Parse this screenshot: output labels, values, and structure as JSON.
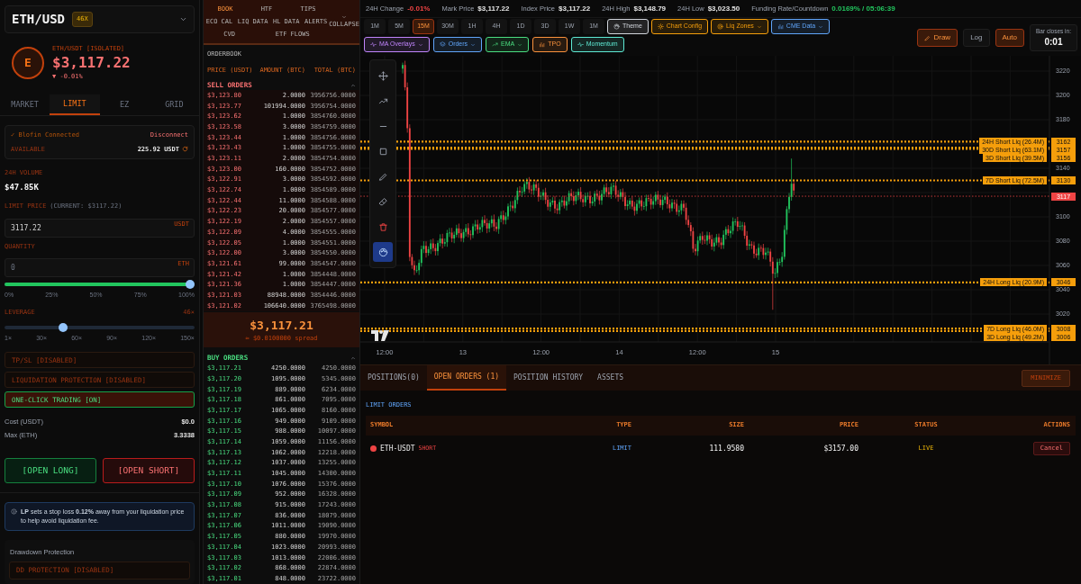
{
  "pair_selector": {
    "symbol": "ETH/USD",
    "leverage_badge": "46X"
  },
  "ticker": {
    "avatar_letter": "E",
    "market": "ETH/USDT [ISOLATED]",
    "price": "$3,117.22",
    "change": "▼ -0.01%"
  },
  "order_tabs": [
    {
      "label": "MARKET",
      "selected": false
    },
    {
      "label": "LIMIT",
      "selected": true
    },
    {
      "label": "EZ",
      "selected": false
    },
    {
      "label": "GRID",
      "selected": false
    }
  ],
  "connection": {
    "status": "✓ Blofin Connected",
    "action": "Disconnect",
    "available_label": "AVAILABLE",
    "available_value": "225.92 USDT"
  },
  "volume": {
    "label": "24H VOLUME",
    "value": "$47.85K"
  },
  "limit_price": {
    "label": "LIMIT PRICE",
    "hint": "(CURRENT: $3117.22)",
    "value": "3117.22",
    "unit": "USDT"
  },
  "quantity": {
    "label": "QUANTITY",
    "placeholder": "0",
    "unit": "ETH"
  },
  "quantity_slider": {
    "level": 1.0,
    "ticks": [
      "0%",
      "25%",
      "50%",
      "75%",
      "100%"
    ]
  },
  "leverage": {
    "label": "LEVERAGE",
    "value": "46×",
    "level": 0.3,
    "ticks": [
      "1×",
      "30×",
      "60×",
      "90×",
      "120×",
      "150×"
    ]
  },
  "toggles": [
    {
      "label": "TP/SL [DISABLED]",
      "on": false
    },
    {
      "label": "LIQUIDATION PROTECTION [DISABLED]",
      "on": false
    },
    {
      "label": "ONE-CLICK TRADING [ON]",
      "on": true
    }
  ],
  "summary": [
    {
      "label": "Cost (USDT)",
      "value": "$0.0"
    },
    {
      "label": "Max (ETH)",
      "value": "3.3338"
    }
  ],
  "actions": [
    {
      "label": "[OPEN LONG]",
      "kind": "long"
    },
    {
      "label": "[OPEN SHORT]",
      "kind": "short"
    }
  ],
  "info": "**LP** sets a stop loss **0.12%** away from your liquidation price to help avoid liquidation fee.",
  "drawdown": {
    "label": "Drawdown Protection",
    "toggle": {
      "label": "DD PROTECTION [DISABLED]",
      "on": false
    }
  },
  "orderbook": {
    "tab_rows": [
      [
        {
          "label": "BOOK",
          "selected": true
        },
        {
          "label": "HTF",
          "selected": false
        },
        {
          "label": "TIPS",
          "selected": false
        }
      ],
      [
        {
          "label": "ECO CAL",
          "selected": false
        },
        {
          "label": "LIQ DATA",
          "selected": false
        },
        {
          "label": "HL DATA",
          "selected": false
        },
        {
          "label": "ALERTS",
          "selected": false
        }
      ],
      [
        {
          "label": "CVD",
          "selected": false
        },
        {
          "label": "ETF FLOWS",
          "selected": false
        }
      ]
    ],
    "collapse": "COLLAPSE",
    "title": "ORDERBOOK",
    "columns": [
      "PRICE (USDT)",
      "AMOUNT (BTC)",
      "TOTAL (BTC)"
    ],
    "sell": {
      "title": "SELL ORDERS",
      "rows": [
        [
          "$3,123.80",
          "2.0000",
          "3956756.0000"
        ],
        [
          "$3,123.77",
          "101994.0000",
          "3956754.0000"
        ],
        [
          "$3,123.62",
          "1.0000",
          "3854760.0000"
        ],
        [
          "$3,123.58",
          "3.0000",
          "3854759.0000"
        ],
        [
          "$3,123.44",
          "1.0000",
          "3854756.0000"
        ],
        [
          "$3,123.43",
          "1.0000",
          "3854755.0000"
        ],
        [
          "$3,123.11",
          "2.0000",
          "3854754.0000"
        ],
        [
          "$3,123.00",
          "160.0000",
          "3854752.0000"
        ],
        [
          "$3,122.91",
          "3.0000",
          "3854592.0000"
        ],
        [
          "$3,122.74",
          "1.0000",
          "3854589.0000"
        ],
        [
          "$3,122.44",
          "11.0000",
          "3854588.0000"
        ],
        [
          "$3,122.23",
          "20.0000",
          "3854577.0000"
        ],
        [
          "$3,122.19",
          "2.0000",
          "3854557.0000"
        ],
        [
          "$3,122.09",
          "4.0000",
          "3854555.0000"
        ],
        [
          "$3,122.05",
          "1.0000",
          "3854551.0000"
        ],
        [
          "$3,122.00",
          "3.0000",
          "3854550.0000"
        ],
        [
          "$3,121.61",
          "99.0000",
          "3854547.0000"
        ],
        [
          "$3,121.42",
          "1.0000",
          "3854448.0000"
        ],
        [
          "$3,121.36",
          "1.0000",
          "3854447.0000"
        ],
        [
          "$3,121.03",
          "88948.0000",
          "3854446.0000"
        ],
        [
          "$3,121.02",
          "106640.0000",
          "3765498.0000"
        ]
      ]
    },
    "mid": {
      "price": "$3,117.21",
      "spread": "≈ $0.0100000 spread"
    },
    "buy": {
      "title": "BUY ORDERS",
      "rows": [
        [
          "$3,117.21",
          "4250.0000",
          "4250.0000"
        ],
        [
          "$3,117.20",
          "1095.0000",
          "5345.0000"
        ],
        [
          "$3,117.19",
          "889.0000",
          "6234.0000"
        ],
        [
          "$3,117.18",
          "861.0000",
          "7095.0000"
        ],
        [
          "$3,117.17",
          "1065.0000",
          "8160.0000"
        ],
        [
          "$3,117.16",
          "949.0000",
          "9109.0000"
        ],
        [
          "$3,117.15",
          "988.0000",
          "10097.0000"
        ],
        [
          "$3,117.14",
          "1059.0000",
          "11156.0000"
        ],
        [
          "$3,117.13",
          "1062.0000",
          "12218.0000"
        ],
        [
          "$3,117.12",
          "1037.0000",
          "13255.0000"
        ],
        [
          "$3,117.11",
          "1045.0000",
          "14300.0000"
        ],
        [
          "$3,117.10",
          "1076.0000",
          "15376.0000"
        ],
        [
          "$3,117.09",
          "952.0000",
          "16328.0000"
        ],
        [
          "$3,117.08",
          "915.0000",
          "17243.0000"
        ],
        [
          "$3,117.07",
          "836.0000",
          "18079.0000"
        ],
        [
          "$3,117.06",
          "1011.0000",
          "19090.0000"
        ],
        [
          "$3,117.05",
          "880.0000",
          "19970.0000"
        ],
        [
          "$3,117.04",
          "1023.0000",
          "20993.0000"
        ],
        [
          "$3,117.03",
          "1013.0000",
          "22006.0000"
        ],
        [
          "$3,117.02",
          "868.0000",
          "22874.0000"
        ],
        [
          "$3,117.01",
          "848.0000",
          "23722.0000"
        ]
      ]
    }
  },
  "stats": [
    {
      "label": "24H Change",
      "value": "-0.01%",
      "color": "#ef4444"
    },
    {
      "label": "Mark Price",
      "value": "$3,117.22",
      "color": "#e5e5e5"
    },
    {
      "label": "Index Price",
      "value": "$3,117.22",
      "color": "#e5e5e5"
    },
    {
      "label": "24H High",
      "value": "$3,148.79",
      "color": "#e5e5e5"
    },
    {
      "label": "24H Low",
      "value": "$3,023.50",
      "color": "#e5e5e5"
    },
    {
      "label": "Funding Rate/Countdown",
      "value": "0.0169% / 05:06:39",
      "color": "#22c55e"
    }
  ],
  "timeframes": [
    {
      "label": "1M",
      "selected": false
    },
    {
      "label": "5M",
      "selected": false
    },
    {
      "label": "15M",
      "selected": true
    },
    {
      "label": "30M",
      "selected": false
    },
    {
      "label": "1H",
      "selected": false
    },
    {
      "label": "4H",
      "selected": false
    },
    {
      "label": "1D",
      "selected": false
    },
    {
      "label": "3D",
      "selected": false
    },
    {
      "label": "1W",
      "selected": false
    },
    {
      "label": "1M",
      "selected": false
    }
  ],
  "tools_row1": [
    {
      "label": "Theme",
      "color": "#d1d5db",
      "dropdown": false
    },
    {
      "label": "Chart Config",
      "color": "#f59e0b",
      "dropdown": false
    },
    {
      "label": "Liq Zones",
      "color": "#f59e0b",
      "dropdown": true
    },
    {
      "label": "CME Data",
      "color": "#60a5fa",
      "dropdown": true
    }
  ],
  "tools_row2": [
    {
      "label": "MA Overlays",
      "color": "#c084fc",
      "dropdown": true
    },
    {
      "label": "Orders",
      "color": "#60a5fa",
      "dropdown": true
    },
    {
      "label": "EMA",
      "color": "#4ade80",
      "dropdown": true
    },
    {
      "label": "TPO",
      "color": "#fb923c",
      "dropdown": false
    },
    {
      "label": "Momentum",
      "color": "#5eead4",
      "dropdown": false
    }
  ],
  "chart_controls": [
    {
      "label": "Draw",
      "active": true
    },
    {
      "label": "Log",
      "active": false
    },
    {
      "label": "Auto",
      "active": true
    }
  ],
  "bar_timer": {
    "label": "Bar closes in:",
    "value": "0:01"
  },
  "price_axis": [
    "3220",
    "3200",
    "3180",
    "3140",
    "3100",
    "3080",
    "3060",
    "3040",
    "3020"
  ],
  "price_levels": [
    {
      "kind": "liquidation",
      "label": "24H Short Liq (26.4M)",
      "price": "3162"
    },
    {
      "kind": "liquidation",
      "label": "30D Short Liq (63.1M)",
      "price": "3157"
    },
    {
      "kind": "liquidation",
      "label": "3D Short Liq (39.5M)",
      "price": "3156"
    },
    {
      "kind": "liquidation",
      "label": "7D Short Liq (72.5M)",
      "price": "3130"
    },
    {
      "kind": "last",
      "price": "3117"
    },
    {
      "kind": "liquidation",
      "label": "24H Long Liq (20.9M)",
      "price": "3046"
    },
    {
      "kind": "liquidation",
      "label": "7D Long Liq (46.0M)",
      "price": "3008"
    },
    {
      "kind": "liquidation",
      "label": "3D Long Liq (49.2M)",
      "price": "3006"
    }
  ],
  "time_axis": [
    "12:00",
    "13",
    "12:00",
    "14",
    "12:00",
    "15"
  ],
  "bottom_tabs": [
    {
      "label": "POSITIONS(0)",
      "selected": false
    },
    {
      "label": "OPEN ORDERS (1)",
      "selected": true
    },
    {
      "label": "POSITION HISTORY",
      "selected": false
    },
    {
      "label": "ASSETS",
      "selected": false
    }
  ],
  "minimize": "MINIMIZE",
  "orders_section": "LIMIT ORDERS",
  "orders_columns": [
    "SYMBOL",
    "TYPE",
    "SIZE",
    "PRICE",
    "STATUS",
    "ACTIONS"
  ],
  "orders": [
    {
      "symbol": "ETH-USDT",
      "side": "SHORT",
      "color": "#ef4444",
      "type": "LIMIT",
      "size": "111.9580",
      "price": "$3157.00",
      "status": "LIVE",
      "action": "Cancel"
    }
  ]
}
